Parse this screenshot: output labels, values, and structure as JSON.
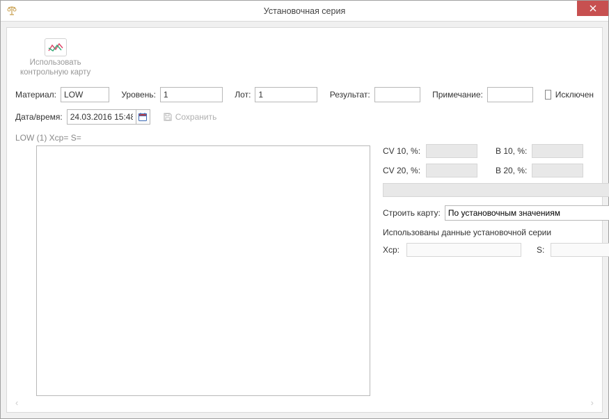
{
  "window": {
    "title": "Установочная серия"
  },
  "toolbar": {
    "use_chart_label_line1": "Использовать",
    "use_chart_label_line2": "контрольную карту"
  },
  "fields": {
    "material_label": "Материал:",
    "material_value": "LOW",
    "level_label": "Уровень:",
    "level_value": "1",
    "lot_label": "Лот:",
    "lot_value": "1",
    "result_label": "Результат:",
    "result_value": "",
    "note_label": "Примечание:",
    "note_value": "",
    "excluded_label": "Исключен",
    "datetime_label": "Дата/время:",
    "datetime_value": "24.03.2016 15:48",
    "save_label": "Сохранить"
  },
  "chart": {
    "header": "LOW (1)   Xcp=    S="
  },
  "stats": {
    "cv10_label": "CV 10, %:",
    "cv10_value": "",
    "b10_label": "B 10, %:",
    "b10_value": "",
    "cv20_label": "CV 20, %:",
    "cv20_value": "",
    "b20_label": "B 20, %:",
    "b20_value": "",
    "build_chart_label": "Строить карту:",
    "build_chart_selected": "По установочным значениям",
    "used_data_label": "Использованы данные установочной серии",
    "xcp_label": "Xcp:",
    "xcp_value": "",
    "s_label": "S:",
    "s_value": ""
  },
  "pager": {
    "prev": "‹",
    "next": "›"
  }
}
